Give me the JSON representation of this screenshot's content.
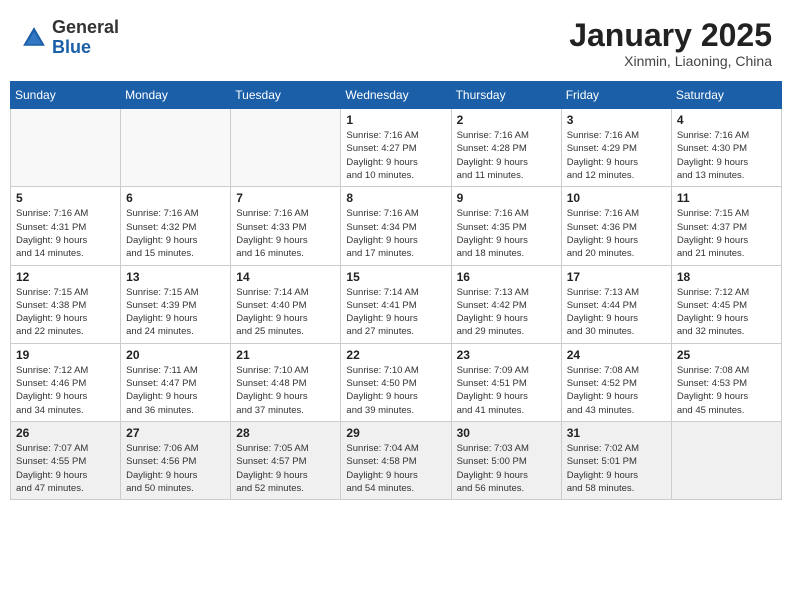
{
  "header": {
    "logo_general": "General",
    "logo_blue": "Blue",
    "month_year": "January 2025",
    "location": "Xinmin, Liaoning, China"
  },
  "days_of_week": [
    "Sunday",
    "Monday",
    "Tuesday",
    "Wednesday",
    "Thursday",
    "Friday",
    "Saturday"
  ],
  "weeks": [
    [
      {
        "day": "",
        "info": ""
      },
      {
        "day": "",
        "info": ""
      },
      {
        "day": "",
        "info": ""
      },
      {
        "day": "1",
        "info": "Sunrise: 7:16 AM\nSunset: 4:27 PM\nDaylight: 9 hours\nand 10 minutes."
      },
      {
        "day": "2",
        "info": "Sunrise: 7:16 AM\nSunset: 4:28 PM\nDaylight: 9 hours\nand 11 minutes."
      },
      {
        "day": "3",
        "info": "Sunrise: 7:16 AM\nSunset: 4:29 PM\nDaylight: 9 hours\nand 12 minutes."
      },
      {
        "day": "4",
        "info": "Sunrise: 7:16 AM\nSunset: 4:30 PM\nDaylight: 9 hours\nand 13 minutes."
      }
    ],
    [
      {
        "day": "5",
        "info": "Sunrise: 7:16 AM\nSunset: 4:31 PM\nDaylight: 9 hours\nand 14 minutes."
      },
      {
        "day": "6",
        "info": "Sunrise: 7:16 AM\nSunset: 4:32 PM\nDaylight: 9 hours\nand 15 minutes."
      },
      {
        "day": "7",
        "info": "Sunrise: 7:16 AM\nSunset: 4:33 PM\nDaylight: 9 hours\nand 16 minutes."
      },
      {
        "day": "8",
        "info": "Sunrise: 7:16 AM\nSunset: 4:34 PM\nDaylight: 9 hours\nand 17 minutes."
      },
      {
        "day": "9",
        "info": "Sunrise: 7:16 AM\nSunset: 4:35 PM\nDaylight: 9 hours\nand 18 minutes."
      },
      {
        "day": "10",
        "info": "Sunrise: 7:16 AM\nSunset: 4:36 PM\nDaylight: 9 hours\nand 20 minutes."
      },
      {
        "day": "11",
        "info": "Sunrise: 7:15 AM\nSunset: 4:37 PM\nDaylight: 9 hours\nand 21 minutes."
      }
    ],
    [
      {
        "day": "12",
        "info": "Sunrise: 7:15 AM\nSunset: 4:38 PM\nDaylight: 9 hours\nand 22 minutes."
      },
      {
        "day": "13",
        "info": "Sunrise: 7:15 AM\nSunset: 4:39 PM\nDaylight: 9 hours\nand 24 minutes."
      },
      {
        "day": "14",
        "info": "Sunrise: 7:14 AM\nSunset: 4:40 PM\nDaylight: 9 hours\nand 25 minutes."
      },
      {
        "day": "15",
        "info": "Sunrise: 7:14 AM\nSunset: 4:41 PM\nDaylight: 9 hours\nand 27 minutes."
      },
      {
        "day": "16",
        "info": "Sunrise: 7:13 AM\nSunset: 4:42 PM\nDaylight: 9 hours\nand 29 minutes."
      },
      {
        "day": "17",
        "info": "Sunrise: 7:13 AM\nSunset: 4:44 PM\nDaylight: 9 hours\nand 30 minutes."
      },
      {
        "day": "18",
        "info": "Sunrise: 7:12 AM\nSunset: 4:45 PM\nDaylight: 9 hours\nand 32 minutes."
      }
    ],
    [
      {
        "day": "19",
        "info": "Sunrise: 7:12 AM\nSunset: 4:46 PM\nDaylight: 9 hours\nand 34 minutes."
      },
      {
        "day": "20",
        "info": "Sunrise: 7:11 AM\nSunset: 4:47 PM\nDaylight: 9 hours\nand 36 minutes."
      },
      {
        "day": "21",
        "info": "Sunrise: 7:10 AM\nSunset: 4:48 PM\nDaylight: 9 hours\nand 37 minutes."
      },
      {
        "day": "22",
        "info": "Sunrise: 7:10 AM\nSunset: 4:50 PM\nDaylight: 9 hours\nand 39 minutes."
      },
      {
        "day": "23",
        "info": "Sunrise: 7:09 AM\nSunset: 4:51 PM\nDaylight: 9 hours\nand 41 minutes."
      },
      {
        "day": "24",
        "info": "Sunrise: 7:08 AM\nSunset: 4:52 PM\nDaylight: 9 hours\nand 43 minutes."
      },
      {
        "day": "25",
        "info": "Sunrise: 7:08 AM\nSunset: 4:53 PM\nDaylight: 9 hours\nand 45 minutes."
      }
    ],
    [
      {
        "day": "26",
        "info": "Sunrise: 7:07 AM\nSunset: 4:55 PM\nDaylight: 9 hours\nand 47 minutes."
      },
      {
        "day": "27",
        "info": "Sunrise: 7:06 AM\nSunset: 4:56 PM\nDaylight: 9 hours\nand 50 minutes."
      },
      {
        "day": "28",
        "info": "Sunrise: 7:05 AM\nSunset: 4:57 PM\nDaylight: 9 hours\nand 52 minutes."
      },
      {
        "day": "29",
        "info": "Sunrise: 7:04 AM\nSunset: 4:58 PM\nDaylight: 9 hours\nand 54 minutes."
      },
      {
        "day": "30",
        "info": "Sunrise: 7:03 AM\nSunset: 5:00 PM\nDaylight: 9 hours\nand 56 minutes."
      },
      {
        "day": "31",
        "info": "Sunrise: 7:02 AM\nSunset: 5:01 PM\nDaylight: 9 hours\nand 58 minutes."
      },
      {
        "day": "",
        "info": ""
      }
    ]
  ]
}
